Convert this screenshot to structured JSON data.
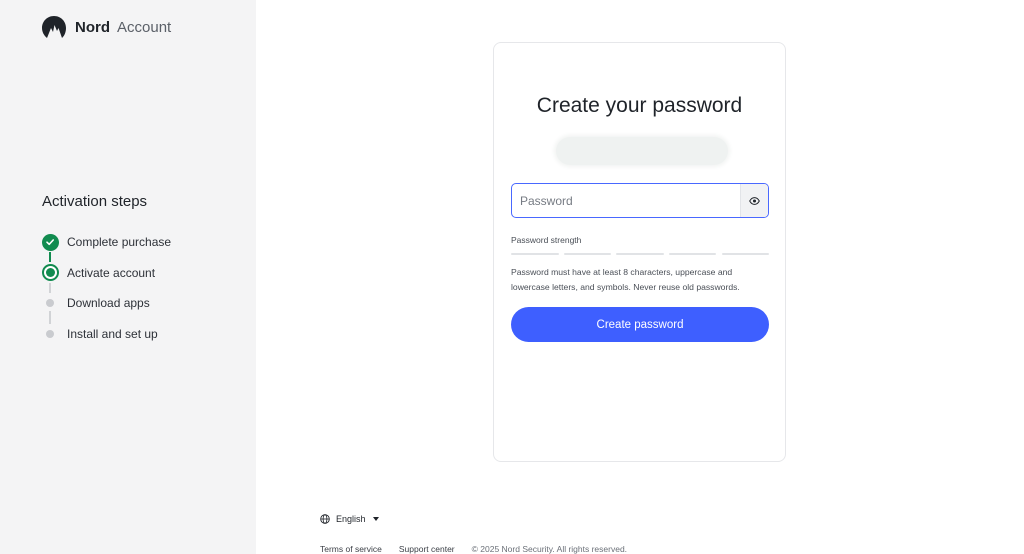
{
  "brand": {
    "name": "Nord",
    "product": "Account"
  },
  "sidebar": {
    "title": "Activation steps",
    "steps": [
      {
        "label": "Complete purchase",
        "state": "done"
      },
      {
        "label": "Activate account",
        "state": "active"
      },
      {
        "label": "Download apps",
        "state": "pending"
      },
      {
        "label": "Install and set up",
        "state": "pending"
      }
    ]
  },
  "card": {
    "title": "Create your password",
    "password_placeholder": "Password",
    "strength_label": "Password strength",
    "strength_segments": 5,
    "hint": "Password must have at least 8 characters, uppercase and lowercase letters, and symbols. Never reuse old passwords.",
    "submit_label": "Create password"
  },
  "footer": {
    "language": "English",
    "links": [
      "Terms of service",
      "Support center"
    ],
    "copyright": "© 2025 Nord Security. All rights reserved."
  },
  "colors": {
    "accent": "#3e5fff",
    "success": "#118b4f",
    "sidebar_bg": "#f4f4f5"
  },
  "icons": {
    "logo": "nord-mountain-logo",
    "step_done": "check-circle-icon",
    "visibility": "eye-icon",
    "language": "globe-icon",
    "dropdown": "caret-down-icon"
  }
}
